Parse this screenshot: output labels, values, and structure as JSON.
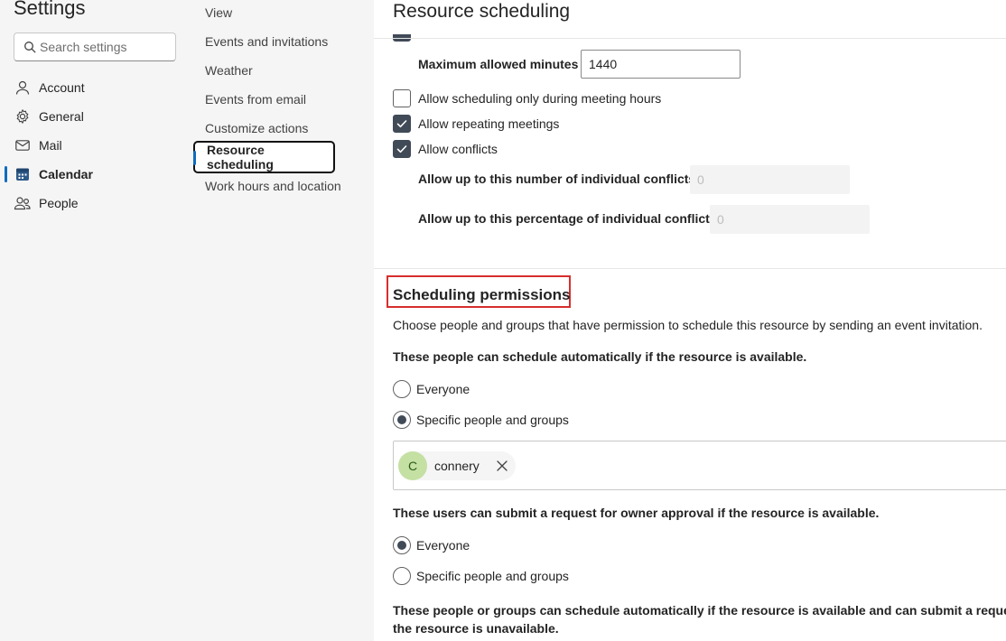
{
  "app": {
    "title": "Settings"
  },
  "search": {
    "placeholder": "Search settings"
  },
  "nav": {
    "items": [
      {
        "label": "Account",
        "icon": "person-icon"
      },
      {
        "label": "General",
        "icon": "gear-icon"
      },
      {
        "label": "Mail",
        "icon": "mail-icon"
      },
      {
        "label": "Calendar",
        "icon": "calendar-icon",
        "active": true
      },
      {
        "label": "People",
        "icon": "people-icon"
      }
    ]
  },
  "subnav": {
    "items": [
      {
        "label": "View"
      },
      {
        "label": "Events and invitations"
      },
      {
        "label": "Weather"
      },
      {
        "label": "Events from email"
      },
      {
        "label": "Customize actions"
      },
      {
        "label": "Resource scheduling",
        "selected": true
      },
      {
        "label": "Work hours and location"
      }
    ]
  },
  "content": {
    "title": "Resource scheduling",
    "max_minutes_label": "Maximum allowed minutes",
    "max_minutes_value": "1440",
    "options": [
      {
        "label": "Allow scheduling only during meeting hours",
        "checked": false
      },
      {
        "label": "Allow repeating meetings",
        "checked": true
      },
      {
        "label": "Allow conflicts",
        "checked": true
      }
    ],
    "conflicts_number_label": "Allow up to this number of individual conflicts",
    "conflicts_number_value": "0",
    "conflicts_percent_label": "Allow up to this percentage of individual conflicts",
    "conflicts_percent_value": "0"
  },
  "permissions": {
    "title": "Scheduling permissions",
    "description": "Choose people and groups that have permission to schedule this resource by sending an event invitation.",
    "auto_heading": "These people can schedule automatically if the resource is available.",
    "auto_options": [
      {
        "label": "Everyone",
        "selected": false
      },
      {
        "label": "Specific people and groups",
        "selected": true
      }
    ],
    "people": [
      {
        "initial": "C",
        "name": "connery"
      }
    ],
    "request_heading": "These users can submit a request for owner approval if the resource is available.",
    "request_options": [
      {
        "label": "Everyone",
        "selected": true
      },
      {
        "label": "Specific people and groups",
        "selected": false
      }
    ],
    "both_heading_line1": "These people or groups can schedule automatically if the resource is available and can submit a request for",
    "both_heading_line2": "the resource is unavailable."
  },
  "colors": {
    "accent": "#0f6cbd",
    "checkbox_fill": "#414a57",
    "highlight_box": "#d72e2e",
    "avatar_bg": "#c4e0a3"
  }
}
